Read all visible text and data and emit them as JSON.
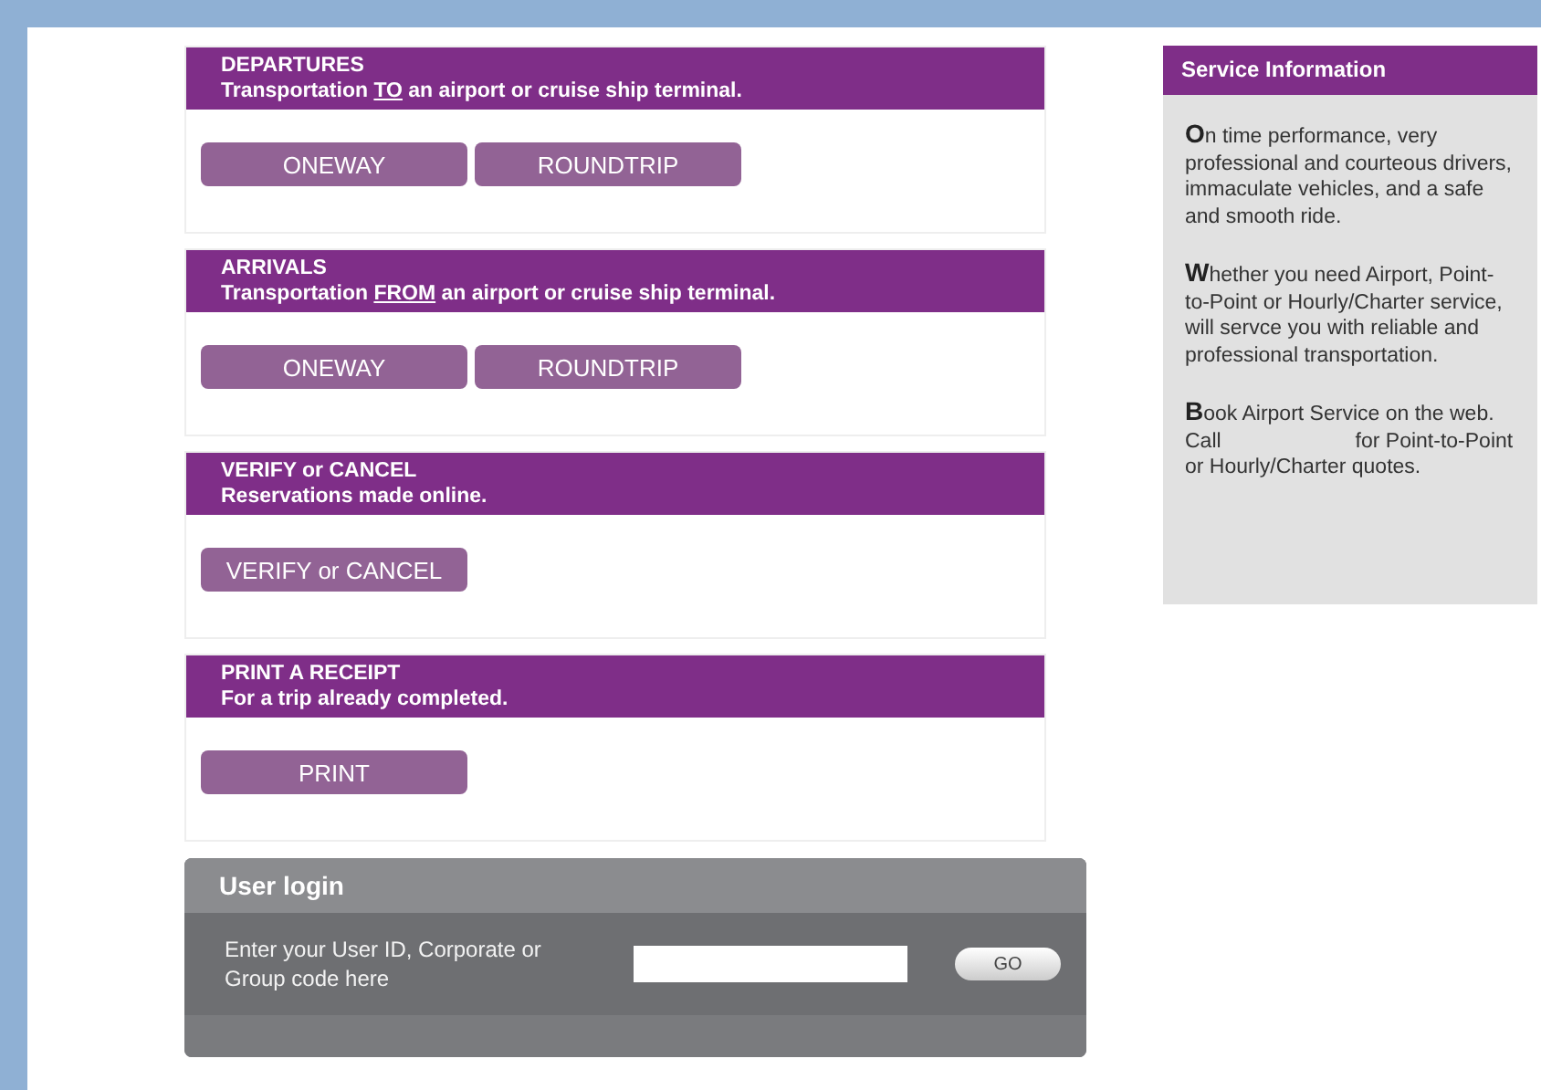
{
  "sections": [
    {
      "title": "DEPARTURES",
      "subtitle": [
        {
          "text": "Transportation ",
          "underlined": false
        },
        {
          "text": "TO",
          "underlined": true
        },
        {
          "text": " an airport or cruise ship terminal.",
          "underlined": false
        }
      ],
      "buttons": [
        "ONEWAY",
        "ROUNDTRIP"
      ]
    },
    {
      "title": "ARRIVALS",
      "subtitle": [
        {
          "text": "Transportation ",
          "underlined": false
        },
        {
          "text": "FROM",
          "underlined": true
        },
        {
          "text": " an airport or cruise ship terminal.",
          "underlined": false
        }
      ],
      "buttons": [
        "ONEWAY",
        "ROUNDTRIP"
      ]
    },
    {
      "title": "VERIFY or CANCEL",
      "subtitle": [
        {
          "text": "Reservations made online.",
          "underlined": false
        }
      ],
      "buttons": [
        "VERIFY or CANCEL"
      ]
    },
    {
      "title": "PRINT A RECEIPT",
      "subtitle": [
        {
          "text": "For a trip already completed.",
          "underlined": false
        }
      ],
      "buttons": [
        "PRINT"
      ]
    }
  ],
  "login": {
    "title": "User login",
    "prompt": "Enter your User ID, Corporate or Group code here",
    "button": "GO"
  },
  "service_info": {
    "title": "Service Information",
    "paragraphs": [
      "**O**n time performance, very professional and courteous drivers, immaculate vehicles, and a safe and smooth ride.",
      "**W**hether you need Airport, Point-to-Point or Hourly/Charter service,               will servce you with reliable and professional transportation.",
      "**B**ook Airport Service on the web. Call                       for Point-to-Point or Hourly/Charter quotes."
    ]
  }
}
